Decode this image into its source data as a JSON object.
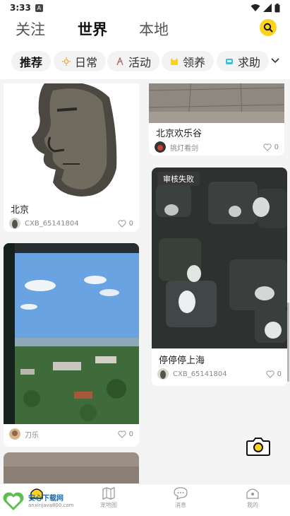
{
  "status_bar": {
    "time": "3:33",
    "notif_badge": "A"
  },
  "tabs": [
    {
      "label": "关注"
    },
    {
      "label": "世界"
    },
    {
      "label": "本地"
    }
  ],
  "categories": [
    {
      "label": "推荐",
      "icon": "none"
    },
    {
      "label": "日常",
      "icon": "sun-icon"
    },
    {
      "label": "活动",
      "icon": "flag-icon"
    },
    {
      "label": "领养",
      "icon": "cat-icon"
    },
    {
      "label": "求助",
      "icon": "help-icon"
    }
  ],
  "feed": {
    "left": [
      {
        "title": "北京",
        "user": "CXB_65141804",
        "likes": "0"
      },
      {
        "title": "",
        "user": "刀乐",
        "likes": "0"
      }
    ],
    "right": [
      {
        "title": "北京欢乐谷",
        "user": "挑灯看剑",
        "likes": "0"
      },
      {
        "title": "停停停上海",
        "user": "CXB_65141804",
        "likes": "0",
        "badge": "审核失败"
      }
    ]
  },
  "nav": [
    {
      "label": ""
    },
    {
      "label": "宠地图"
    },
    {
      "label": "消息"
    },
    {
      "label": "我的"
    }
  ],
  "watermark": {
    "name": "安心下载网",
    "url": "anxinjava800.com"
  },
  "colors": {
    "accent": "#fbd31c",
    "text": "#222222",
    "muted": "#888888"
  }
}
